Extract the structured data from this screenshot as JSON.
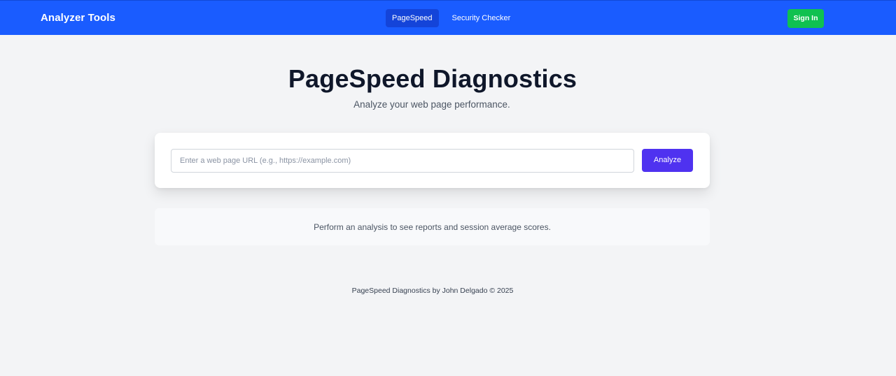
{
  "navbar": {
    "brand": "Analyzer Tools",
    "links": [
      {
        "label": "PageSpeed",
        "active": true
      },
      {
        "label": "Security Checker",
        "active": false
      }
    ],
    "signin_label": "Sign In"
  },
  "hero": {
    "title": "PageSpeed Diagnostics",
    "subtitle": "Analyze your web page performance."
  },
  "search": {
    "placeholder": "Enter a web page URL (e.g., https://example.com)",
    "value": "",
    "button_label": "Analyze"
  },
  "info": {
    "message": "Perform an analysis to see reports and session average scores."
  },
  "footer": {
    "text": "PageSpeed Diagnostics by John Delgado © 2025"
  },
  "colors": {
    "nav_bg": "#1a5cff",
    "nav_active": "#1444d9",
    "signin_bg": "#0fc150",
    "analyze_bg": "#4f32f0",
    "page_bg": "#f3f4f6"
  }
}
